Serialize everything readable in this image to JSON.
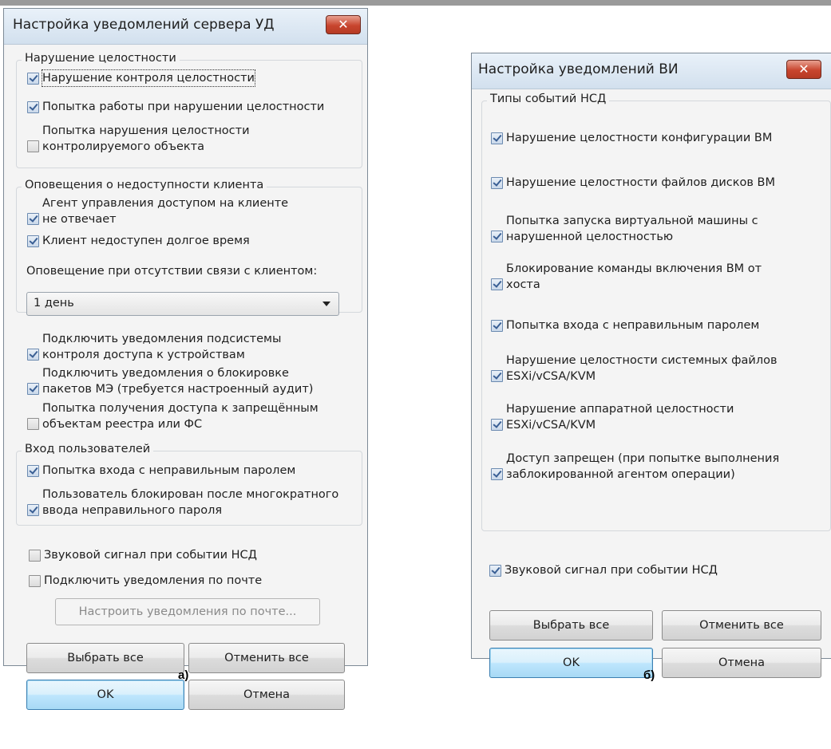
{
  "dialog_a": {
    "title": "Настройка уведомлений сервера УД",
    "close_glyph": "✕",
    "group_integrity": {
      "legend": "Нарушение целостности",
      "items": [
        {
          "label": "Нарушение контроля целостности",
          "checked": true
        },
        {
          "label": "Попытка работы при нарушении целостности",
          "checked": true
        },
        {
          "label_lines": [
            "Попытка нарушения целостности",
            "контролируемого объекта"
          ],
          "checked": false
        }
      ]
    },
    "group_client": {
      "legend": "Оповещения о недоступности клиента",
      "items": [
        {
          "label_lines": [
            "Агент управления доступом на клиенте",
            "не отвечает"
          ],
          "checked": true
        },
        {
          "label": "Клиент недоступен долгое время",
          "checked": true
        }
      ],
      "no_link_label": "Оповещение при отсутствии связи с клиентом:",
      "period_select": {
        "value": "1 день"
      }
    },
    "extra_items": [
      {
        "label_lines": [
          "Подключить уведомления подсистемы",
          "контроля доступа к устройствам"
        ],
        "checked": true
      },
      {
        "label_lines": [
          "Подключить уведомления о блокировке",
          "пакетов МЭ (требуется настроенный аудит)"
        ],
        "checked": true
      },
      {
        "label_lines": [
          "Попытка получения доступа к запрещённым",
          "объектам реестра или ФС"
        ],
        "checked": false
      }
    ],
    "group_login": {
      "legend": "Вход пользователей",
      "items": [
        {
          "label": "Попытка входа с неправильным паролем",
          "checked": true
        },
        {
          "label_lines": [
            "Пользователь блокирован после многократного",
            "ввода неправильного пароля"
          ],
          "checked": true
        }
      ]
    },
    "sound_item": {
      "label": "Звуковой сигнал при событии НСД",
      "checked": false
    },
    "mail_item": {
      "label": "Подключить уведомления по почте",
      "checked": false
    },
    "mail_settings_button": "Настроить уведомления по почте...",
    "select_all_button": "Выбрать все",
    "deselect_all_button": "Отменить все",
    "ok_button": "OK",
    "cancel_button": "Отмена",
    "caption": "а)"
  },
  "dialog_b": {
    "title": "Настройка уведомлений ВИ",
    "close_glyph": "✕",
    "group_events": {
      "legend": "Типы событий НСД",
      "items": [
        {
          "label": "Нарушение целостности конфигурации ВМ",
          "checked": true
        },
        {
          "label": "Нарушение целостности файлов дисков ВМ",
          "checked": true
        },
        {
          "label_lines": [
            "Попытка запуска виртуальной машины с",
            "нарушенной целостностью"
          ],
          "checked": true
        },
        {
          "label_lines": [
            "Блокирование команды включения ВМ от",
            "хоста"
          ],
          "checked": true
        },
        {
          "label": "Попытка входа с неправильным паролем",
          "checked": true
        },
        {
          "label_lines": [
            "Нарушение целостности системных файлов",
            "ESXi/vCSA/KVM"
          ],
          "checked": true
        },
        {
          "label_lines": [
            "Нарушение аппаратной целостности",
            "ESXi/vCSA/KVM"
          ],
          "checked": true
        },
        {
          "label_lines": [
            "Доступ запрещен (при попытке выполнения",
            "заблокированной агентом операции)"
          ],
          "checked": true
        }
      ]
    },
    "sound_item": {
      "label": "Звуковой сигнал при событии НСД",
      "checked": true
    },
    "select_all_button": "Выбрать все",
    "deselect_all_button": "Отменить все",
    "ok_button": "OK",
    "cancel_button": "Отмена",
    "caption": "б)"
  }
}
